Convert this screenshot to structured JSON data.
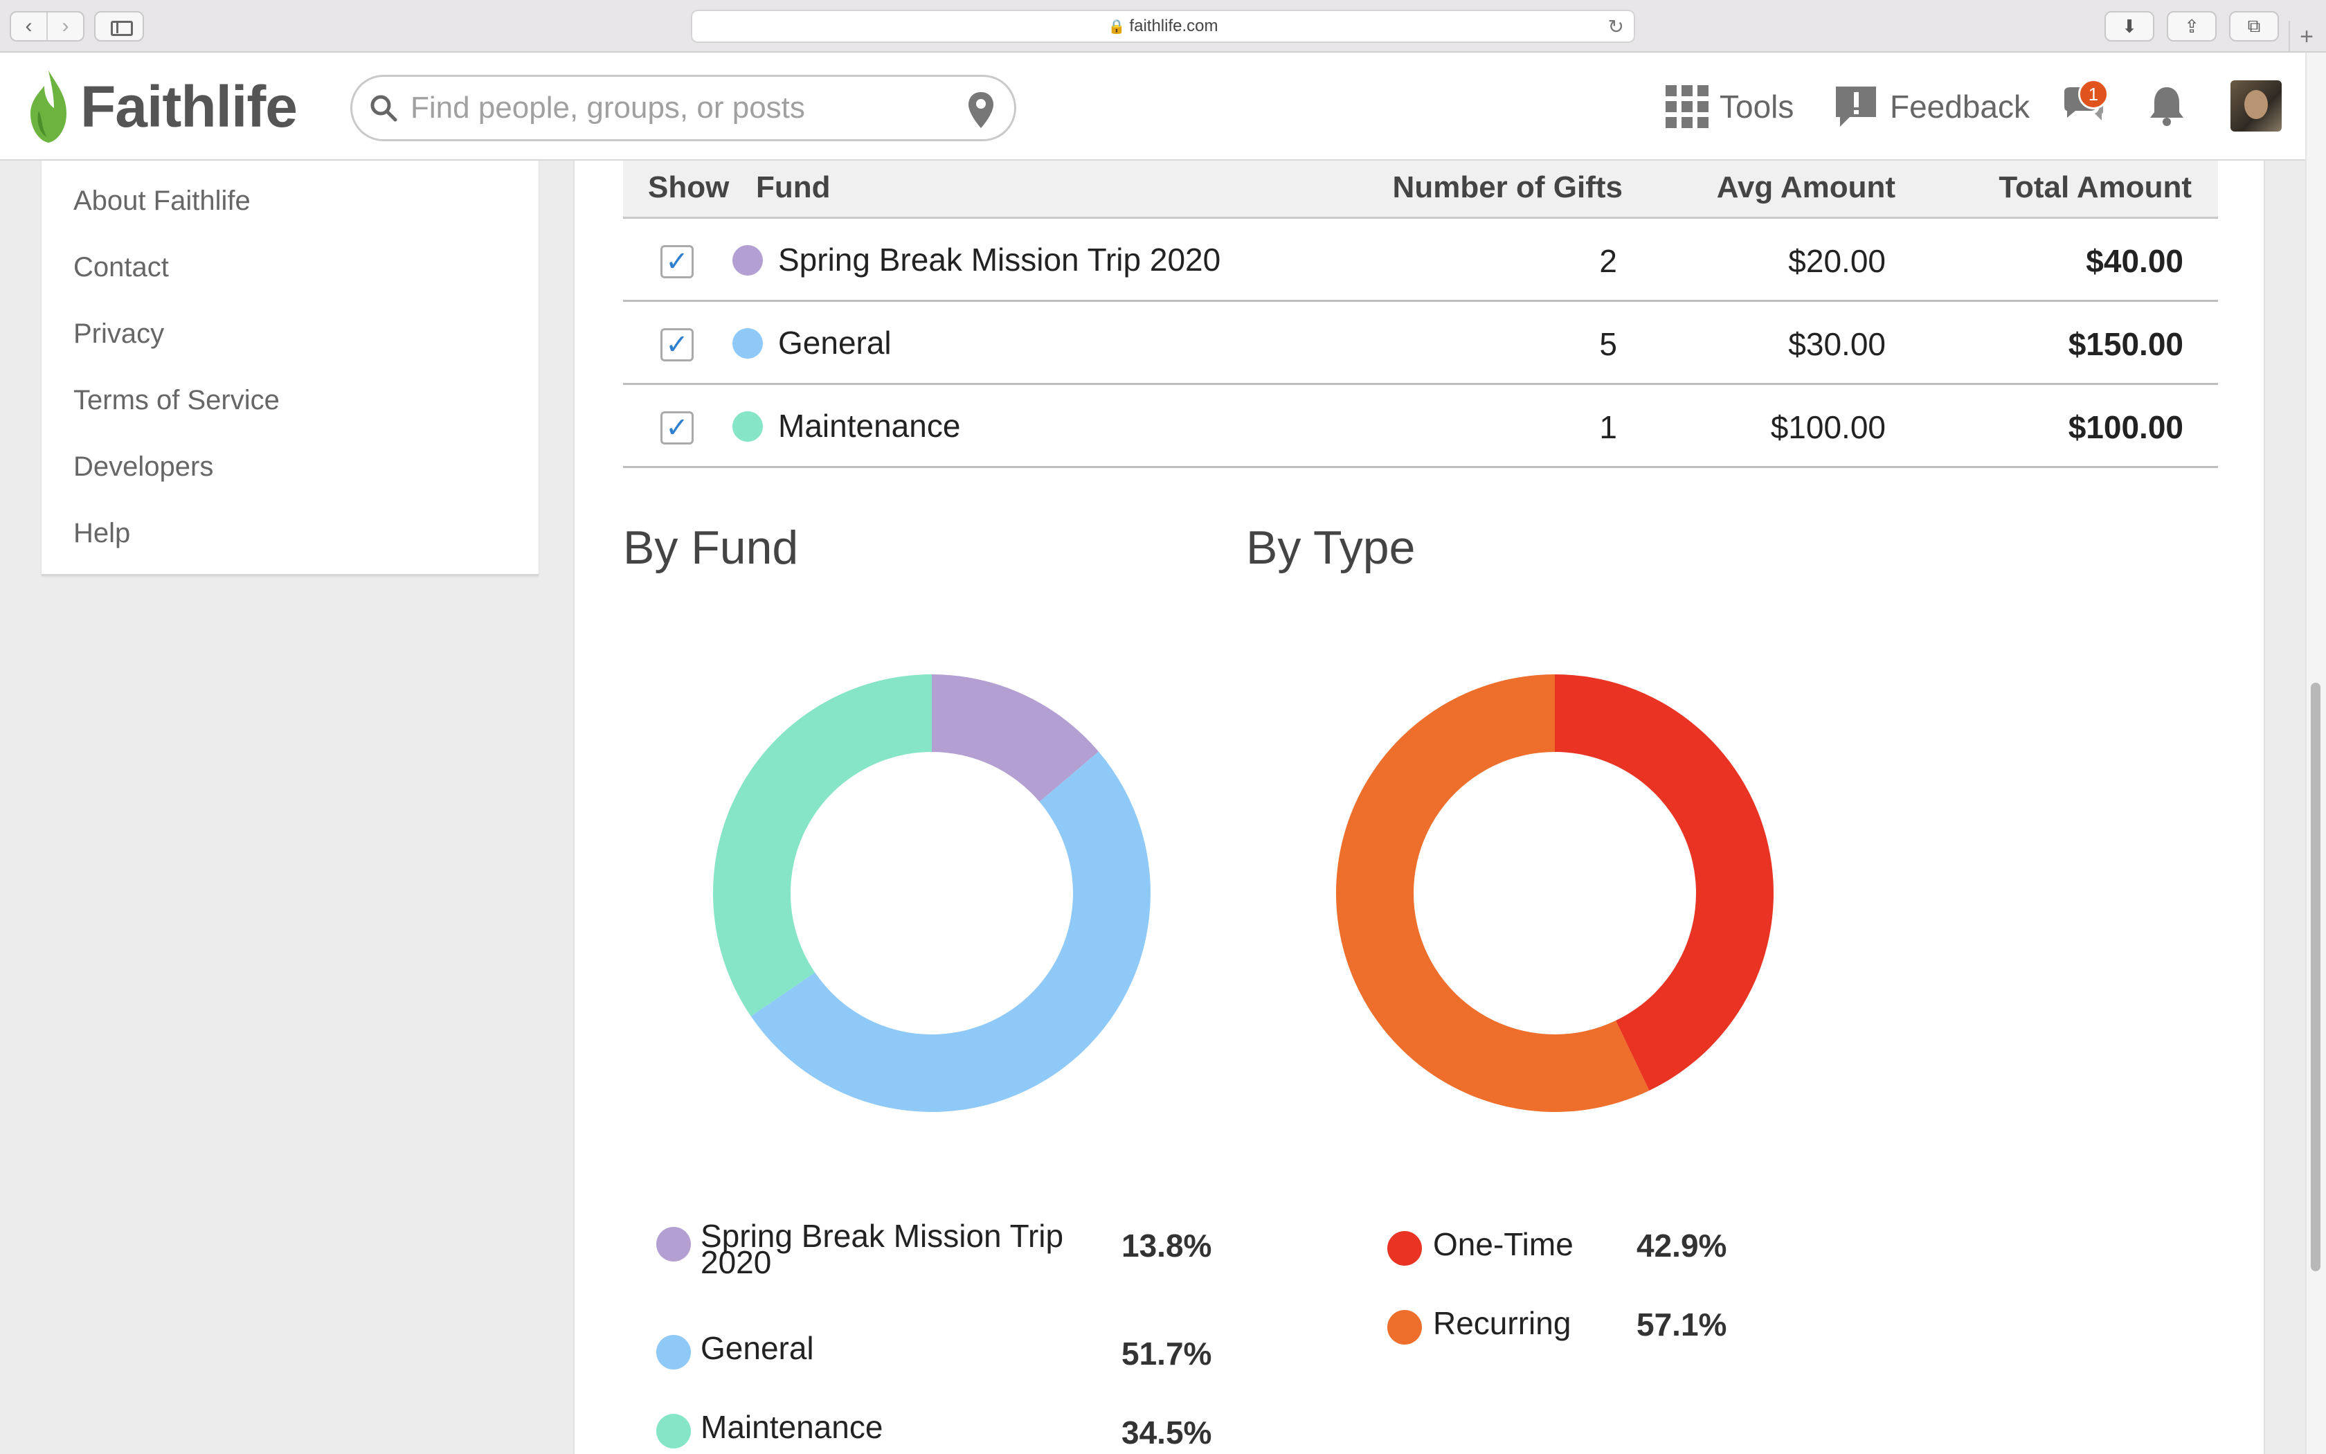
{
  "browser": {
    "url": "faithlife.com"
  },
  "header": {
    "logo_text": "Faithlife",
    "search_placeholder": "Find people, groups, or posts",
    "tools_label": "Tools",
    "feedback_label": "Feedback",
    "messages_badge": "1"
  },
  "sidebar": {
    "items": [
      {
        "label": "About Faithlife"
      },
      {
        "label": "Contact"
      },
      {
        "label": "Privacy"
      },
      {
        "label": "Terms of Service"
      },
      {
        "label": "Developers"
      },
      {
        "label": "Help"
      }
    ]
  },
  "table": {
    "headers": {
      "show": "Show",
      "fund": "Fund",
      "gifts": "Number of Gifts",
      "avg": "Avg Amount",
      "total": "Total Amount"
    },
    "rows": [
      {
        "fund": "Spring Break Mission Trip 2020",
        "gifts": "2",
        "avg": "$20.00",
        "total": "$40.00",
        "color": "#b39fd1",
        "checked": true
      },
      {
        "fund": "General",
        "gifts": "5",
        "avg": "$30.00",
        "total": "$150.00",
        "color": "#8ec9f7",
        "checked": true
      },
      {
        "fund": "Maintenance",
        "gifts": "1",
        "avg": "$100.00",
        "total": "$100.00",
        "color": "#85e5c6",
        "checked": true
      }
    ]
  },
  "charts": {
    "by_fund_title": "By Fund",
    "by_type_title": "By Type"
  },
  "chart_data": [
    {
      "type": "pie",
      "title": "By Fund",
      "categories": [
        "Spring Break Mission Trip 2020",
        "General",
        "Maintenance"
      ],
      "values": [
        13.8,
        51.7,
        34.5
      ],
      "labels": [
        "13.8%",
        "51.7%",
        "34.5%"
      ],
      "colors": [
        "#b39fd1",
        "#8ec9f7",
        "#85e5c6"
      ],
      "donut": true
    },
    {
      "type": "pie",
      "title": "By Type",
      "categories": [
        "One-Time",
        "Recurring"
      ],
      "values": [
        42.9,
        57.1
      ],
      "labels": [
        "42.9%",
        "57.1%"
      ],
      "colors": [
        "#e93424",
        "#ee6e2c"
      ],
      "donut": true
    }
  ]
}
